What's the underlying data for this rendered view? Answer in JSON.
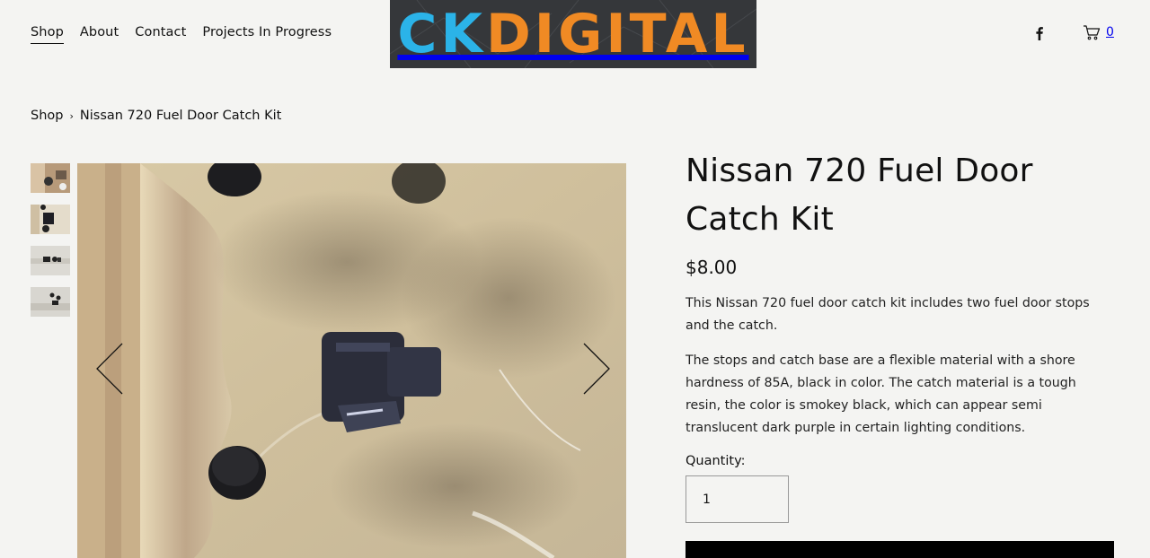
{
  "nav": {
    "items": [
      {
        "label": "Shop"
      },
      {
        "label": "About"
      },
      {
        "label": "Contact"
      },
      {
        "label": "Projects In Progress"
      }
    ]
  },
  "logo": {
    "part1": "CK",
    "part2": "DIGITAL"
  },
  "header": {
    "cart_count": "0",
    "social_icon": "facebook-icon",
    "cart_icon": "cart-icon"
  },
  "breadcrumb": {
    "root": "Shop",
    "separator": "›",
    "current": "Nissan 720 Fuel Door Catch Kit"
  },
  "product": {
    "title": "Nissan 720 Fuel Door Catch Kit",
    "price": "$8.00",
    "description_1": "This Nissan 720 fuel door catch kit includes two fuel door stops and the catch.",
    "description_2": "The stops and catch base are a flexible material with a shore hardness of 85A, black in color. The catch material is a tough resin, the color is smokey black, which can appear semi translucent dark purple in certain lighting conditions.",
    "quantity_label": "Quantity:",
    "quantity_value": "1"
  },
  "colors": {
    "background": "#f4f4f2",
    "logo_bg": "#35373a",
    "logo_blue": "#2bb3e8",
    "logo_orange": "#f08a24",
    "button": "#000000"
  }
}
